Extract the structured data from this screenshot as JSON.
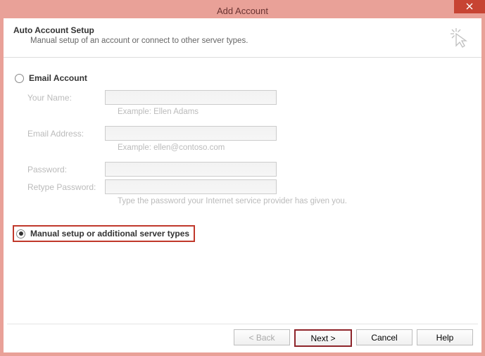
{
  "window": {
    "title": "Add Account"
  },
  "header": {
    "title": "Auto Account Setup",
    "subtitle": "Manual setup of an account or connect to other server types."
  },
  "options": {
    "email_account": "Email Account",
    "manual_setup": "Manual setup or additional server types"
  },
  "form": {
    "your_name_label": "Your Name:",
    "your_name_hint": "Example: Ellen Adams",
    "email_label": "Email Address:",
    "email_hint": "Example: ellen@contoso.com",
    "password_label": "Password:",
    "retype_label": "Retype Password:",
    "password_hint": "Type the password your Internet service provider has given you."
  },
  "buttons": {
    "back": "< Back",
    "next": "Next >",
    "cancel": "Cancel",
    "help": "Help"
  }
}
